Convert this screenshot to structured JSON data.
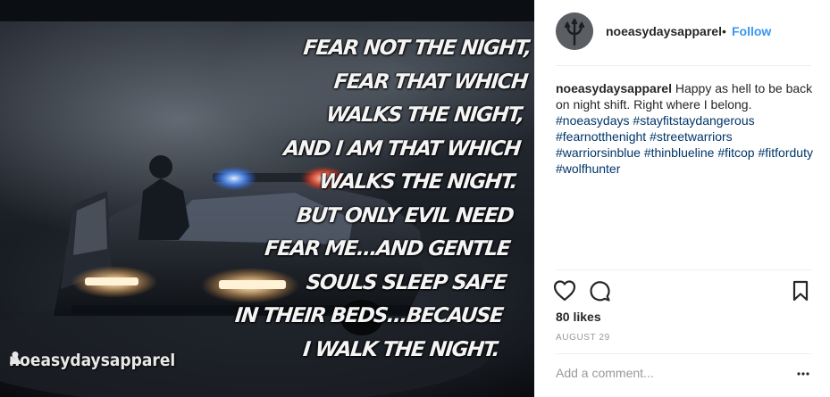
{
  "photo": {
    "quote_lines": [
      "Fear not the night,",
      "fear that which",
      "walks the night,",
      "and I am that which",
      "walks the night.",
      "But only evil need",
      "fear me...and gentle",
      "souls sleep safe",
      "in their beds...because",
      "I walk the night."
    ],
    "watermark": "noeasydaysapparel",
    "watermark_icon": "person-icon"
  },
  "header": {
    "username": "noeasydaysapparel",
    "separator": "•",
    "follow_label": "Follow",
    "avatar_icon": "trident-icon"
  },
  "caption": {
    "author": "noeasydaysapparel",
    "text": "Happy as hell to be back on night shift. Right where I belong.",
    "hashtags": [
      "#noeasydays",
      "#stayfitstaydangerous",
      "#fearnotthenight",
      "#streetwarriors",
      "#warriorsinblue",
      "#thinblueline",
      "#fitcop",
      "#fitforduty",
      "#wolfhunter"
    ]
  },
  "actions": {
    "like_icon": "heart-icon",
    "comment_icon": "comment-icon",
    "save_icon": "bookmark-icon"
  },
  "likes": "80 likes",
  "date": "AUGUST 29",
  "comment": {
    "placeholder": "Add a comment...",
    "value": "",
    "more_icon": "more-icon"
  },
  "colors": {
    "link": "#3897f0",
    "hashtag": "#003569",
    "muted": "#999999",
    "text": "#262626"
  }
}
